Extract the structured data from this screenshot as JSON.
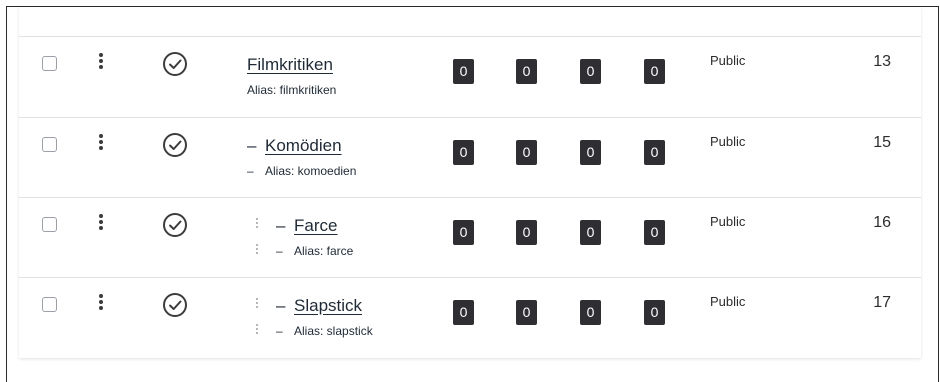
{
  "rows": [
    {
      "title": "Filmkritiken",
      "alias": "Alias: filmkritiken",
      "level": 0,
      "counts": [
        "0",
        "0",
        "0",
        "0"
      ],
      "access": "Public",
      "id": "13"
    },
    {
      "title": "Komödien",
      "alias": "Alias: komoedien",
      "level": 1,
      "counts": [
        "0",
        "0",
        "0",
        "0"
      ],
      "access": "Public",
      "id": "15"
    },
    {
      "title": "Farce",
      "alias": "Alias: farce",
      "level": 2,
      "counts": [
        "0",
        "0",
        "0",
        "0"
      ],
      "access": "Public",
      "id": "16"
    },
    {
      "title": "Slapstick",
      "alias": "Alias: slapstick",
      "level": 2,
      "counts": [
        "0",
        "0",
        "0",
        "0"
      ],
      "access": "Public",
      "id": "17"
    }
  ],
  "level_dash": "–",
  "icons": {
    "select": "checkbox-icon",
    "actions": "kebab-menu-icon",
    "status": "check-circle-icon",
    "drag": "drag-handle-icon"
  },
  "colors": {
    "badge_bg": "#2f2f33",
    "text": "#1f2a36"
  }
}
